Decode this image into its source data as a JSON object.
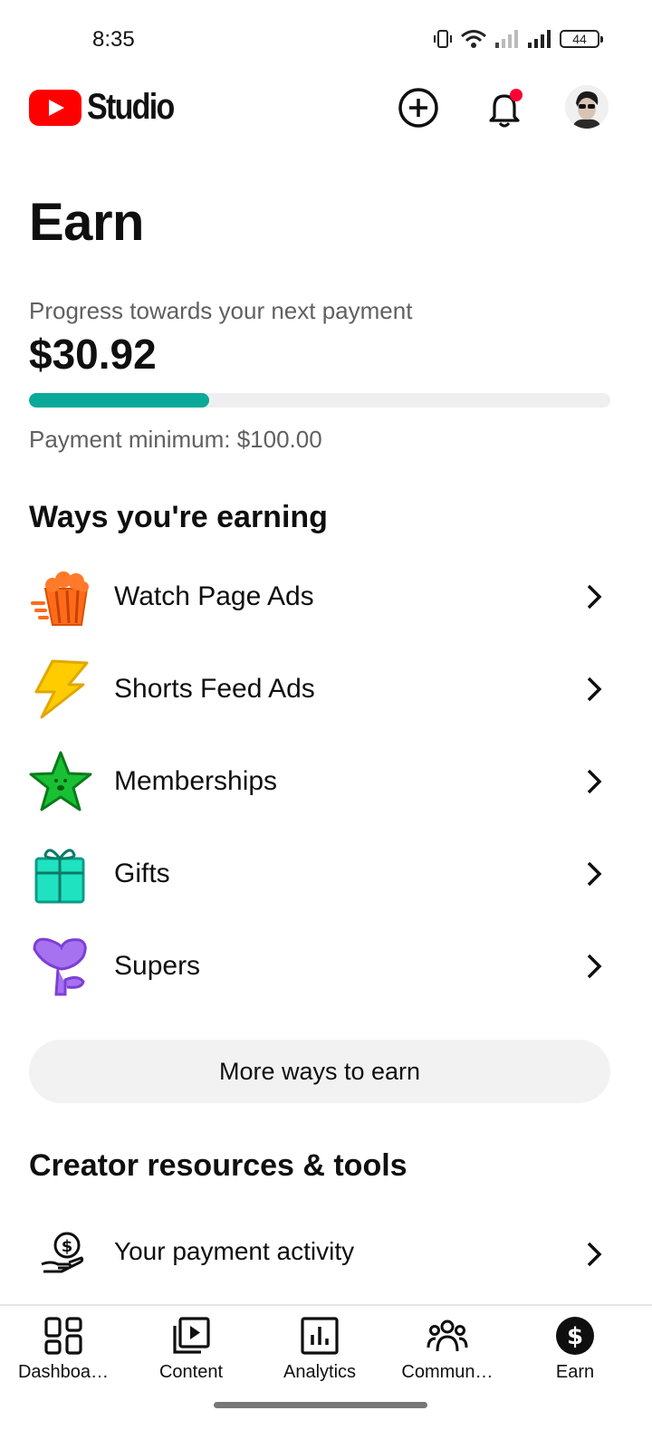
{
  "status_bar": {
    "time": "8:35",
    "battery": "44",
    "icons": [
      "vibrate-icon",
      "wifi-icon",
      "signal-weak-icon",
      "signal-icon",
      "battery-icon"
    ]
  },
  "header": {
    "app_name": "Studio",
    "icons": [
      "create-icon",
      "notifications-icon",
      "avatar"
    ],
    "notification_dot_color": "#ff0033",
    "logo_color": "#ff0000"
  },
  "page": {
    "title": "Earn",
    "progress_label": "Progress towards your next payment",
    "amount": "$30.92",
    "progress_fraction": 0.3092,
    "progress_color": "#0aa99a",
    "payment_minimum": "Payment minimum: $100.00"
  },
  "ways": {
    "title": "Ways you're earning",
    "items": [
      {
        "label": "Watch Page Ads",
        "icon": "popcorn-icon"
      },
      {
        "label": "Shorts Feed Ads",
        "icon": "lightning-icon"
      },
      {
        "label": "Memberships",
        "icon": "star-icon"
      },
      {
        "label": "Gifts",
        "icon": "gift-icon"
      },
      {
        "label": "Supers",
        "icon": "heart-flower-icon"
      }
    ],
    "more_button": "More ways to earn"
  },
  "resources": {
    "title": "Creator resources & tools",
    "items": [
      {
        "label": "Your payment activity",
        "icon": "payment-hand-icon"
      }
    ]
  },
  "nav": {
    "items": [
      {
        "label": "Dashboa…",
        "icon": "dashboard-icon"
      },
      {
        "label": "Content",
        "icon": "content-icon"
      },
      {
        "label": "Analytics",
        "icon": "analytics-icon"
      },
      {
        "label": "Commun…",
        "icon": "community-icon"
      },
      {
        "label": "Earn",
        "icon": "earn-icon"
      }
    ],
    "active": "Earn"
  }
}
